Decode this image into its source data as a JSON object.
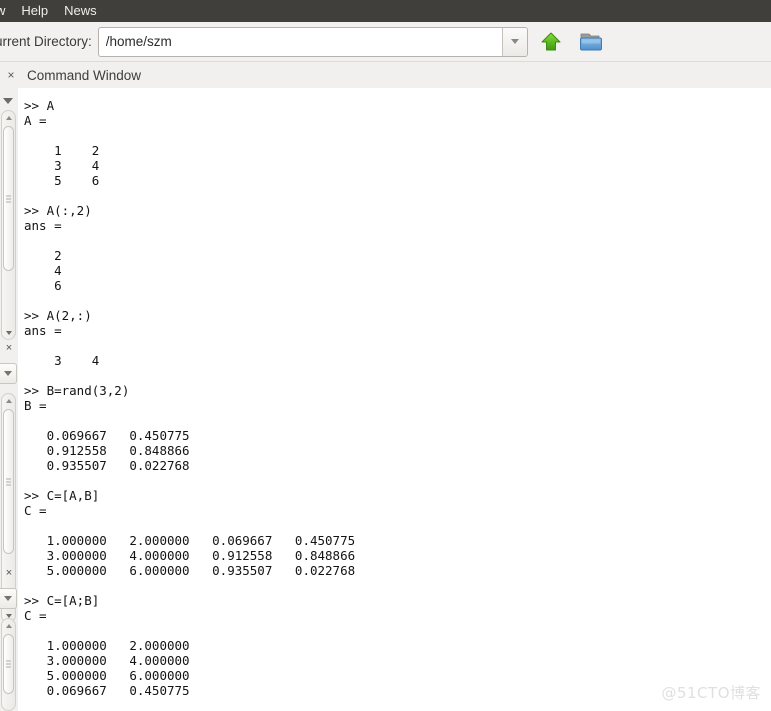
{
  "menubar": {
    "items": [
      {
        "label": "w",
        "name": "menu-window-clipped"
      },
      {
        "label": "Help",
        "name": "menu-help"
      },
      {
        "label": "News",
        "name": "menu-news"
      }
    ]
  },
  "toolbar": {
    "directory_label": "urrent Directory:",
    "directory_value": "/home/szm",
    "directory_placeholder": "/home/szm",
    "up_button_name": "go-up-directory-button",
    "browse_button_name": "browse-folder-button",
    "dropdown_name": "directory-history-dropdown"
  },
  "tabstrip": {
    "close_glyph": "×",
    "title": "Command Window"
  },
  "console": {
    "text": ">> A\nA =\n\n    1    2\n    3    4\n    5    6\n\n>> A(:,2)\nans =\n\n    2\n    4\n    6\n\n>> A(2,:)\nans =\n\n    3    4\n\n>> B=rand(3,2)\nB =\n\n   0.069667   0.450775\n   0.912558   0.848866\n   0.935507   0.022768\n\n>> C=[A,B]\nC =\n\n   1.000000   2.000000   0.069667   0.450775\n   3.000000   4.000000   0.912558   0.848866\n   5.000000   6.000000   0.935507   0.022768\n\n>> C=[A;B]\nC =\n\n   1.000000   2.000000\n   3.000000   4.000000\n   5.000000   6.000000\n   0.069667   0.450775"
  },
  "left_panels": {
    "close_glyph": "×"
  },
  "watermark": {
    "text": "@51CTO博客"
  },
  "colors": {
    "menubar_bg": "#413f3c",
    "toolbar_bg": "#f2f1f0",
    "tabstrip_bg": "#f1f0ee",
    "console_bg": "#ffffff",
    "console_text": "#141414",
    "accent_green": "#5cb622",
    "accent_blue": "#5b9bd5"
  }
}
